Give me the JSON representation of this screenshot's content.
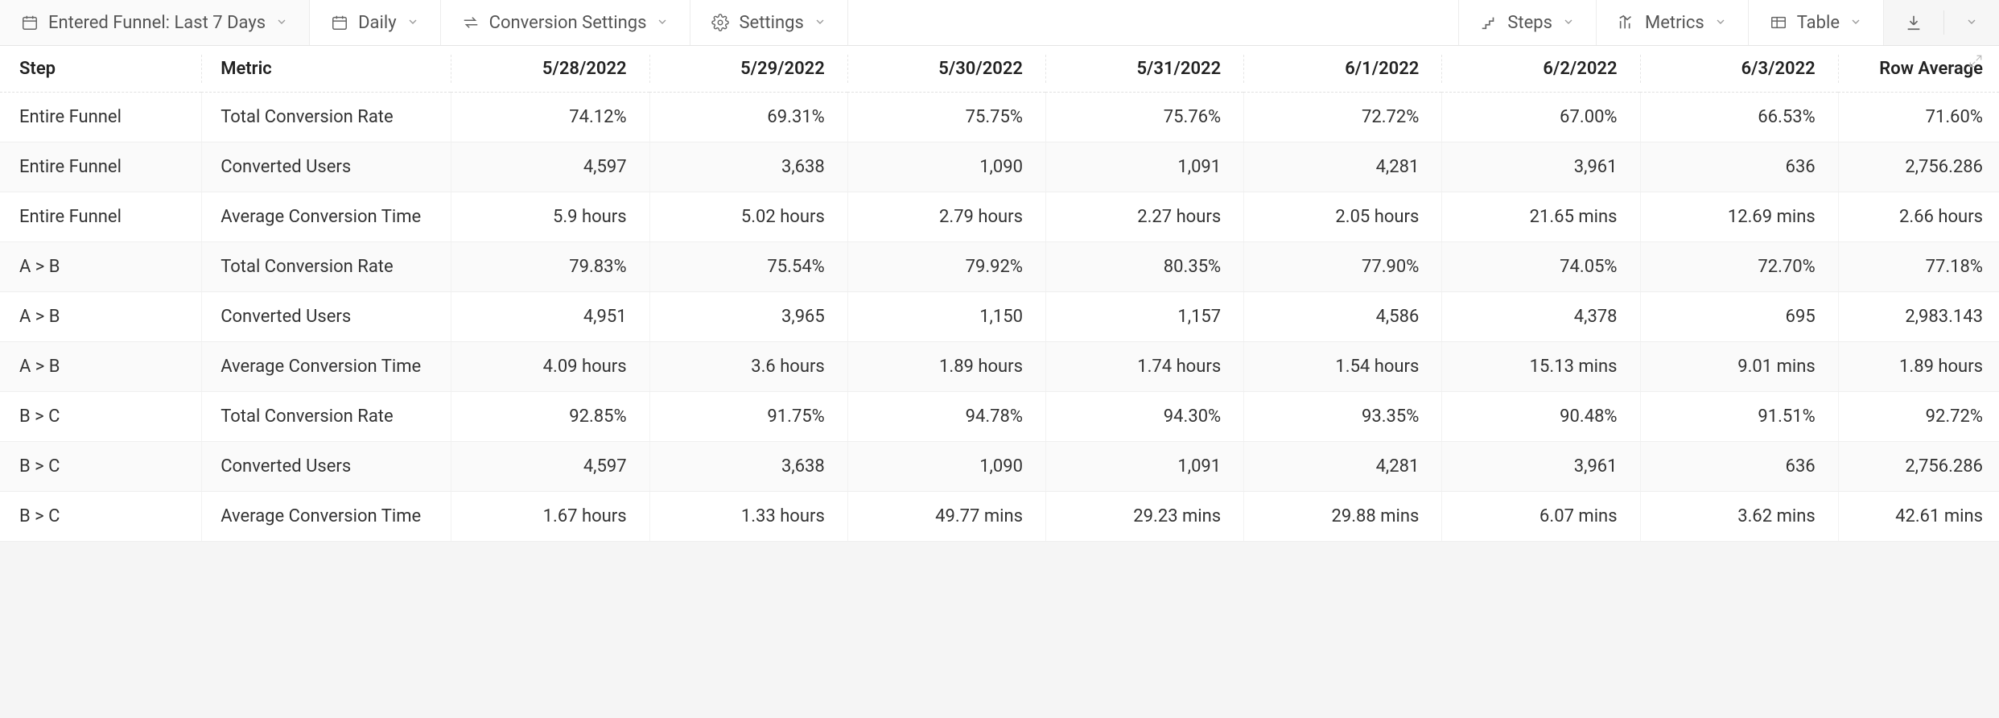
{
  "toolbar": {
    "date_range": "Entered Funnel: Last 7 Days",
    "granularity": "Daily",
    "conversion_settings": "Conversion Settings",
    "settings": "Settings",
    "steps": "Steps",
    "metrics": "Metrics",
    "view": "Table"
  },
  "table": {
    "headers": {
      "step": "Step",
      "metric": "Metric",
      "row_average": "Row Average"
    },
    "dates": [
      "5/28/2022",
      "5/29/2022",
      "5/30/2022",
      "5/31/2022",
      "6/1/2022",
      "6/2/2022",
      "6/3/2022"
    ],
    "rows": [
      {
        "step": "Entire Funnel",
        "metric": "Total Conversion Rate",
        "vals": [
          "74.12%",
          "69.31%",
          "75.75%",
          "75.76%",
          "72.72%",
          "67.00%",
          "66.53%"
        ],
        "avg": "71.60%"
      },
      {
        "step": "Entire Funnel",
        "metric": "Converted Users",
        "vals": [
          "4,597",
          "3,638",
          "1,090",
          "1,091",
          "4,281",
          "3,961",
          "636"
        ],
        "avg": "2,756.286"
      },
      {
        "step": "Entire Funnel",
        "metric": "Average Conversion Time",
        "vals": [
          "5.9 hours",
          "5.02 hours",
          "2.79 hours",
          "2.27 hours",
          "2.05 hours",
          "21.65 mins",
          "12.69 mins"
        ],
        "avg": "2.66 hours"
      },
      {
        "step": "A > B",
        "metric": "Total Conversion Rate",
        "vals": [
          "79.83%",
          "75.54%",
          "79.92%",
          "80.35%",
          "77.90%",
          "74.05%",
          "72.70%"
        ],
        "avg": "77.18%"
      },
      {
        "step": "A > B",
        "metric": "Converted Users",
        "vals": [
          "4,951",
          "3,965",
          "1,150",
          "1,157",
          "4,586",
          "4,378",
          "695"
        ],
        "avg": "2,983.143"
      },
      {
        "step": "A > B",
        "metric": "Average Conversion Time",
        "vals": [
          "4.09 hours",
          "3.6 hours",
          "1.89 hours",
          "1.74 hours",
          "1.54 hours",
          "15.13 mins",
          "9.01 mins"
        ],
        "avg": "1.89 hours"
      },
      {
        "step": "B > C",
        "metric": "Total Conversion Rate",
        "vals": [
          "92.85%",
          "91.75%",
          "94.78%",
          "94.30%",
          "93.35%",
          "90.48%",
          "91.51%"
        ],
        "avg": "92.72%"
      },
      {
        "step": "B > C",
        "metric": "Converted Users",
        "vals": [
          "4,597",
          "3,638",
          "1,090",
          "1,091",
          "4,281",
          "3,961",
          "636"
        ],
        "avg": "2,756.286"
      },
      {
        "step": "B > C",
        "metric": "Average Conversion Time",
        "vals": [
          "1.67 hours",
          "1.33 hours",
          "49.77 mins",
          "29.23 mins",
          "29.88 mins",
          "6.07 mins",
          "3.62 mins"
        ],
        "avg": "42.61 mins"
      }
    ]
  }
}
